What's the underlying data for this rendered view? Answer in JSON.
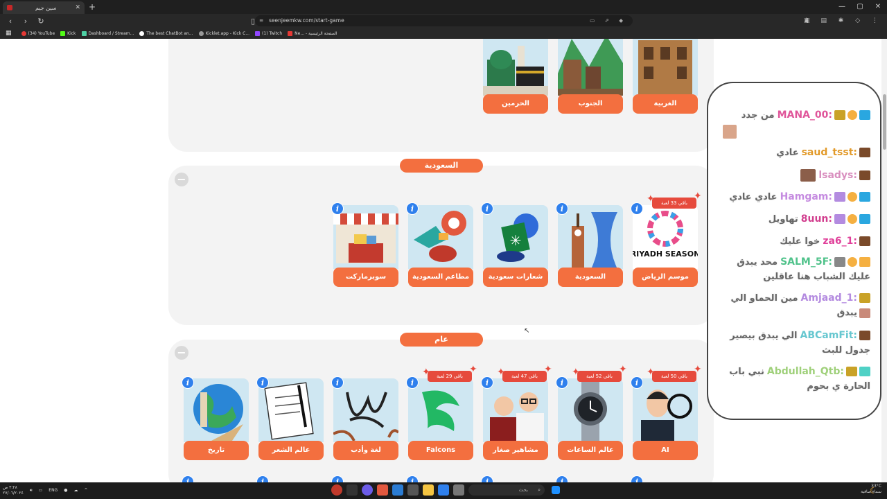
{
  "browser": {
    "tab_title": "سين جيم",
    "url": "seenjeemkw.com/start-game",
    "bookmarks": [
      "(34) YouTube",
      "Kick",
      "Dashboard / Stream...",
      "The best ChatBot an...",
      "Kicklet.app - Kick C...",
      "(1) Twitch",
      "Ne... - الصفحة الرئيسية"
    ]
  },
  "top_row": {
    "cards": [
      {
        "label": "الحرمين"
      },
      {
        "label": "الجنوب"
      },
      {
        "label": "الغربية"
      }
    ]
  },
  "saudi_section": {
    "title": "السعودية",
    "collapse": "−",
    "cards": [
      {
        "label": "سوبرماركت",
        "badge": ""
      },
      {
        "label": "مطاعم السعودية",
        "badge": ""
      },
      {
        "label": "شعارات سعودية",
        "badge": ""
      },
      {
        "label": "السعودية",
        "badge": ""
      },
      {
        "label": "موسم الرياض",
        "badge": "باقي 33 لعبة",
        "art_text": "RIYADH SEASON"
      }
    ]
  },
  "general_section": {
    "title": "عام",
    "collapse": "−",
    "cards": [
      {
        "label": "تاريخ",
        "badge": ""
      },
      {
        "label": "عالم الشعر",
        "badge": ""
      },
      {
        "label": "لغة وأدب",
        "badge": ""
      },
      {
        "label": "Falcons",
        "badge": "باقي 29 لعبة"
      },
      {
        "label": "مشاهير صغار",
        "badge": "باقي 47 لعبة"
      },
      {
        "label": "عالم الساعات",
        "badge": "باقي 52 لعبة"
      },
      {
        "label": "AI",
        "badge": "باقي 50 لعبة"
      }
    ]
  },
  "chat": {
    "messages": [
      {
        "user": "MANA_00:",
        "text": "من جدد",
        "color": "#e0559a"
      },
      {
        "user": "saud_tsst:",
        "text": "عادي",
        "color": "#e29a2a"
      },
      {
        "user": "lsadys:",
        "text": "",
        "color": "#d98fbf"
      },
      {
        "user": "Hamgam:",
        "text": "عادي عادي",
        "color": "#c58be0"
      },
      {
        "user": "8uun:",
        "text": "تهاويل",
        "color": "#d23f8f"
      },
      {
        "user": "za6_1:",
        "text": "خوا عليك",
        "color": "#e0409a"
      },
      {
        "user": "SALM_5F:",
        "text": "محد يبدق",
        "color": "#4fc28a"
      },
      {
        "user": "",
        "text": "عليك الشباب هنا عاقلين",
        "color": "#666"
      },
      {
        "user": "Amjaad_1:",
        "text": "مين الحماو الي",
        "color": "#b48be0"
      },
      {
        "user": "",
        "text": "يبدق",
        "color": "#666"
      },
      {
        "user": "ABCamFit:",
        "text": "الي يبدق بيصير",
        "color": "#66c7d0"
      },
      {
        "user": "",
        "text": "جدول للبث",
        "color": "#666"
      },
      {
        "user": "Abdullah_Qtb:",
        "text": "نبي باب",
        "color": "#9fd07a"
      },
      {
        "user": "",
        "text": "الحارة ي بحوم",
        "color": "#666"
      }
    ]
  },
  "taskbar": {
    "lang": "ENG",
    "search": "بحث",
    "time": "٣:٢٨ ص",
    "date": "٢٧/٠٦/٢٠٢٤",
    "weather": "33°C",
    "weather_desc": "سماء صافية"
  }
}
